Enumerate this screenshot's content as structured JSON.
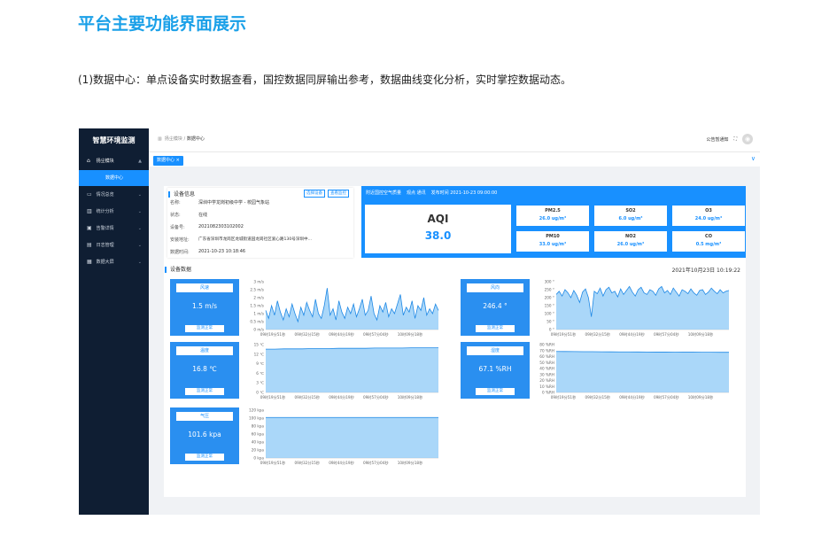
{
  "doc": {
    "title": "平台主要功能界面展示",
    "intro": "(1)数据中心：单点设备实时数据查看，国控数据同屏输出参考，数据曲线变化分析，实时掌控数据动态。"
  },
  "app": {
    "brand": "智慧环境监测",
    "sidebar": [
      {
        "icon": "⌂",
        "icon_name": "home-icon",
        "label": "扬尘模块",
        "chev": "▲",
        "open": true
      },
      {
        "sub": true,
        "label": "数据中心"
      },
      {
        "icon": "▭",
        "icon_name": "monitor-icon",
        "label": "情况总览",
        "chev": "⌄"
      },
      {
        "icon": "▥",
        "icon_name": "bar-chart-icon",
        "label": "统计分析",
        "chev": "⌄"
      },
      {
        "icon": "▣",
        "icon_name": "alert-icon",
        "label": "告警详情",
        "chev": "⌄"
      },
      {
        "icon": "▤",
        "icon_name": "document-icon",
        "label": "日志管理",
        "chev": "⌄"
      },
      {
        "icon": "▦",
        "icon_name": "screen-icon",
        "label": "数据大屏",
        "chev": "⌄"
      }
    ],
    "breadcrumb": {
      "home_icon": "▥",
      "level1": "扬尘模块",
      "sep": "/",
      "current": "数据中心"
    },
    "topbar": {
      "notice": "公告暂通知",
      "fullscreen_icon": "⛶",
      "avatar": "◉"
    },
    "tab": {
      "label": "数据中心 ×",
      "collapse_icon": "∨"
    },
    "device": {
      "title": "设备信息",
      "btn_select": "选择设备",
      "btn_view": "查看监控",
      "fields": [
        {
          "k": "名称:",
          "v": "深圳中学龙岗初级中学 - 校园气象站"
        },
        {
          "k": "状态:",
          "v": "在线"
        },
        {
          "k": "设备号:",
          "v": "2021082303102002"
        },
        {
          "k": "安装地址:",
          "v": "广东省深圳市龙岗区龙城街道园龙岗社区爱心路130号深圳中..."
        },
        {
          "k": "数据时间:",
          "v": "2021-10-23 10:18:46"
        }
      ]
    },
    "air": {
      "title": "附近国控空气质量",
      "station": "观点 通讯",
      "release": "发布时间 2021-10-23 09:00:00",
      "aqi_label": "AQI",
      "aqi_value": "38.0",
      "pollutants": [
        {
          "name": "PM2.5",
          "value": "26.0 ug/m³"
        },
        {
          "name": "SO2",
          "value": "6.0 ug/m³"
        },
        {
          "name": "O3",
          "value": "24.0 ug/m³"
        },
        {
          "name": "PM10",
          "value": "33.0 ug/m³"
        },
        {
          "name": "NO2",
          "value": "26.0 ug/m³"
        },
        {
          "name": "CO",
          "value": "0.5 mg/m³"
        }
      ]
    },
    "data_title": "设备数据",
    "data_time": "2021年10月23日 10:19:22",
    "status_label": "监测正常",
    "x_ticks": [
      "09时19分51秒",
      "09时32分15秒",
      "09时44分19秒",
      "09时57分04秒",
      "10时09分18秒"
    ],
    "metrics": [
      {
        "label": "风速",
        "value": "1.5 m/s"
      },
      {
        "label": "风向",
        "value": "246.4 °"
      },
      {
        "label": "温度",
        "value": "16.8 ℃"
      },
      {
        "label": "湿度",
        "value": "67.1 %RH"
      },
      {
        "label": "气压",
        "value": "101.6 kpa"
      }
    ]
  },
  "chart_data": [
    {
      "type": "area",
      "name": "风速",
      "yticks": [
        "3 m/s",
        "2.5 m/s",
        "2 m/s",
        "1.5 m/s",
        "1 m/s",
        "0.5 m/s",
        "0 m/s"
      ],
      "ylim": [
        0,
        3
      ],
      "values": [
        1.2,
        0.7,
        1.5,
        0.9,
        1.8,
        1.1,
        0.6,
        1.3,
        0.8,
        1.6,
        1.0,
        0.5,
        1.4,
        0.9,
        1.7,
        1.2,
        0.8,
        1.9,
        1.0,
        0.7,
        1.5,
        2.6,
        0.9,
        1.3,
        0.6,
        1.8,
        1.1,
        0.7,
        1.4,
        1.0,
        1.6,
        0.8,
        1.3,
        1.9,
        0.9,
        1.2,
        2.1,
        1.0,
        0.6,
        1.5,
        1.1,
        1.7,
        0.8,
        1.3,
        1.0,
        1.6,
        2.2,
        0.9,
        1.4,
        1.1,
        1.8,
        0.7,
        1.5,
        1.2,
        2.0,
        0.9,
        1.3,
        1.0,
        1.6,
        1.2
      ]
    },
    {
      "type": "area",
      "name": "风向",
      "yticks": [
        "300 °",
        "250 °",
        "200 °",
        "150 °",
        "100 °",
        "50 °",
        "0 °"
      ],
      "ylim": [
        0,
        300
      ],
      "values": [
        220,
        240,
        210,
        250,
        230,
        200,
        245,
        215,
        170,
        235,
        255,
        200,
        80,
        240,
        225,
        260,
        210,
        250,
        265,
        230,
        240,
        205,
        255,
        220,
        245,
        270,
        235,
        210,
        250,
        265,
        230,
        220,
        250,
        240,
        215,
        255,
        270,
        230,
        245,
        220,
        260,
        235,
        210,
        250,
        240,
        225,
        255,
        230,
        215,
        245,
        250,
        220,
        235,
        260,
        240,
        225,
        250,
        230,
        240,
        245
      ]
    },
    {
      "type": "area",
      "name": "温度",
      "yticks": [
        "15 ℃",
        "12 ℃",
        "9 ℃",
        "6 ℃",
        "3 ℃",
        "0 ℃"
      ],
      "ylim": [
        0,
        18
      ],
      "values": [
        16.3,
        16.3,
        16.4,
        16.4,
        16.4,
        16.5,
        16.5,
        16.5,
        16.6,
        16.6,
        16.6,
        16.6,
        16.7,
        16.7,
        16.7,
        16.7,
        16.8,
        16.8,
        16.8,
        16.8
      ]
    },
    {
      "type": "area",
      "name": "湿度",
      "yticks": [
        "80 %RH",
        "70 %RH",
        "60 %RH",
        "50 %RH",
        "40 %RH",
        "30 %RH",
        "20 %RH",
        "10 %RH",
        "0 %RH"
      ],
      "ylim": [
        0,
        80
      ],
      "values": [
        68.5,
        68.4,
        68.3,
        68.2,
        68.1,
        68.0,
        67.9,
        67.8,
        67.8,
        67.7,
        67.6,
        67.5,
        67.5,
        67.4,
        67.3,
        67.3,
        67.2,
        67.2,
        67.1,
        67.1
      ]
    },
    {
      "type": "area",
      "name": "气压",
      "yticks": [
        "120 kpa",
        "100 kpa",
        "80 kpa",
        "60 kpa",
        "40 kpa",
        "20 kpa",
        "0 kpa"
      ],
      "ylim": [
        0,
        120
      ],
      "values": [
        101.6,
        101.6,
        101.6,
        101.6,
        101.6,
        101.6,
        101.6,
        101.6,
        101.6,
        101.6,
        101.6,
        101.6,
        101.6,
        101.6,
        101.6,
        101.6,
        101.6,
        101.6,
        101.6,
        101.6
      ]
    }
  ]
}
